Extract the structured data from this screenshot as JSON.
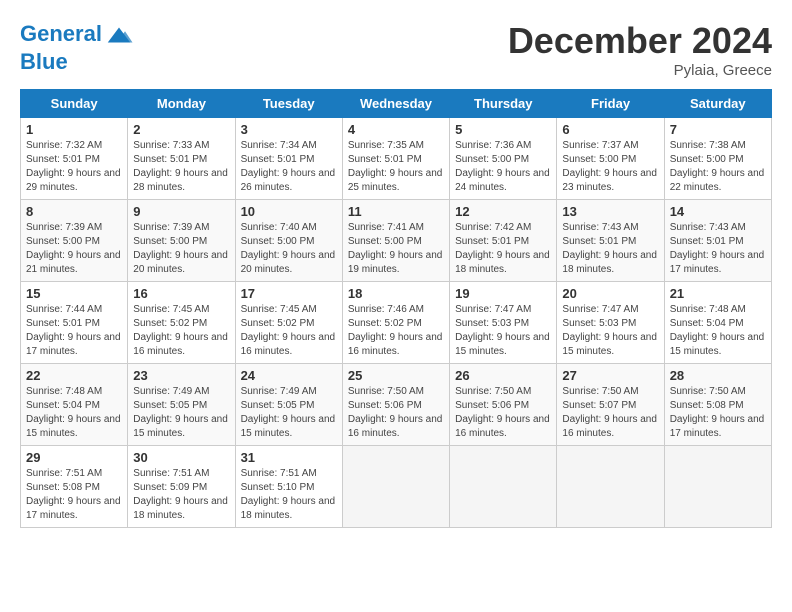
{
  "header": {
    "logo_line1": "General",
    "logo_line2": "Blue",
    "month_title": "December 2024",
    "location": "Pylaia, Greece"
  },
  "days_of_week": [
    "Sunday",
    "Monday",
    "Tuesday",
    "Wednesday",
    "Thursday",
    "Friday",
    "Saturday"
  ],
  "weeks": [
    [
      {
        "num": "1",
        "rise": "7:32 AM",
        "set": "5:01 PM",
        "daylight": "9 hours and 29 minutes."
      },
      {
        "num": "2",
        "rise": "7:33 AM",
        "set": "5:01 PM",
        "daylight": "9 hours and 28 minutes."
      },
      {
        "num": "3",
        "rise": "7:34 AM",
        "set": "5:01 PM",
        "daylight": "9 hours and 26 minutes."
      },
      {
        "num": "4",
        "rise": "7:35 AM",
        "set": "5:01 PM",
        "daylight": "9 hours and 25 minutes."
      },
      {
        "num": "5",
        "rise": "7:36 AM",
        "set": "5:00 PM",
        "daylight": "9 hours and 24 minutes."
      },
      {
        "num": "6",
        "rise": "7:37 AM",
        "set": "5:00 PM",
        "daylight": "9 hours and 23 minutes."
      },
      {
        "num": "7",
        "rise": "7:38 AM",
        "set": "5:00 PM",
        "daylight": "9 hours and 22 minutes."
      }
    ],
    [
      {
        "num": "8",
        "rise": "7:39 AM",
        "set": "5:00 PM",
        "daylight": "9 hours and 21 minutes."
      },
      {
        "num": "9",
        "rise": "7:39 AM",
        "set": "5:00 PM",
        "daylight": "9 hours and 20 minutes."
      },
      {
        "num": "10",
        "rise": "7:40 AM",
        "set": "5:00 PM",
        "daylight": "9 hours and 20 minutes."
      },
      {
        "num": "11",
        "rise": "7:41 AM",
        "set": "5:00 PM",
        "daylight": "9 hours and 19 minutes."
      },
      {
        "num": "12",
        "rise": "7:42 AM",
        "set": "5:01 PM",
        "daylight": "9 hours and 18 minutes."
      },
      {
        "num": "13",
        "rise": "7:43 AM",
        "set": "5:01 PM",
        "daylight": "9 hours and 18 minutes."
      },
      {
        "num": "14",
        "rise": "7:43 AM",
        "set": "5:01 PM",
        "daylight": "9 hours and 17 minutes."
      }
    ],
    [
      {
        "num": "15",
        "rise": "7:44 AM",
        "set": "5:01 PM",
        "daylight": "9 hours and 17 minutes."
      },
      {
        "num": "16",
        "rise": "7:45 AM",
        "set": "5:02 PM",
        "daylight": "9 hours and 16 minutes."
      },
      {
        "num": "17",
        "rise": "7:45 AM",
        "set": "5:02 PM",
        "daylight": "9 hours and 16 minutes."
      },
      {
        "num": "18",
        "rise": "7:46 AM",
        "set": "5:02 PM",
        "daylight": "9 hours and 16 minutes."
      },
      {
        "num": "19",
        "rise": "7:47 AM",
        "set": "5:03 PM",
        "daylight": "9 hours and 15 minutes."
      },
      {
        "num": "20",
        "rise": "7:47 AM",
        "set": "5:03 PM",
        "daylight": "9 hours and 15 minutes."
      },
      {
        "num": "21",
        "rise": "7:48 AM",
        "set": "5:04 PM",
        "daylight": "9 hours and 15 minutes."
      }
    ],
    [
      {
        "num": "22",
        "rise": "7:48 AM",
        "set": "5:04 PM",
        "daylight": "9 hours and 15 minutes."
      },
      {
        "num": "23",
        "rise": "7:49 AM",
        "set": "5:05 PM",
        "daylight": "9 hours and 15 minutes."
      },
      {
        "num": "24",
        "rise": "7:49 AM",
        "set": "5:05 PM",
        "daylight": "9 hours and 15 minutes."
      },
      {
        "num": "25",
        "rise": "7:50 AM",
        "set": "5:06 PM",
        "daylight": "9 hours and 16 minutes."
      },
      {
        "num": "26",
        "rise": "7:50 AM",
        "set": "5:06 PM",
        "daylight": "9 hours and 16 minutes."
      },
      {
        "num": "27",
        "rise": "7:50 AM",
        "set": "5:07 PM",
        "daylight": "9 hours and 16 minutes."
      },
      {
        "num": "28",
        "rise": "7:50 AM",
        "set": "5:08 PM",
        "daylight": "9 hours and 17 minutes."
      }
    ],
    [
      {
        "num": "29",
        "rise": "7:51 AM",
        "set": "5:08 PM",
        "daylight": "9 hours and 17 minutes."
      },
      {
        "num": "30",
        "rise": "7:51 AM",
        "set": "5:09 PM",
        "daylight": "9 hours and 18 minutes."
      },
      {
        "num": "31",
        "rise": "7:51 AM",
        "set": "5:10 PM",
        "daylight": "9 hours and 18 minutes."
      },
      null,
      null,
      null,
      null
    ]
  ]
}
